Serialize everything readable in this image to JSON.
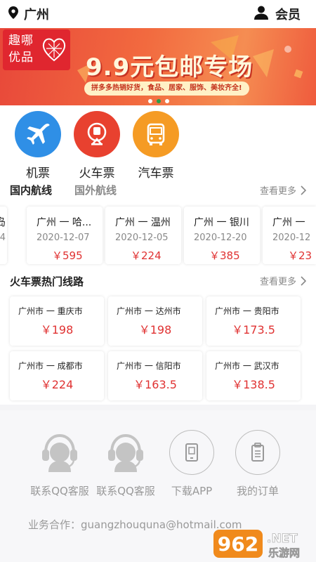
{
  "header": {
    "location": "广州",
    "member_label": "会员"
  },
  "banner": {
    "logo_text": "趣哪优品",
    "title": "9.9元包邮专场",
    "subtitle": "拼多多热销好货，食品、居家、服饰、美妆齐全!"
  },
  "categories": [
    {
      "label": "机票",
      "icon": "airplane-icon",
      "color": "#2f8fe6"
    },
    {
      "label": "火车票",
      "icon": "train-icon",
      "color": "#e8412f"
    },
    {
      "label": "汽车票",
      "icon": "bus-icon",
      "color": "#f59b24"
    }
  ],
  "flights": {
    "tab_domestic": "国内航线",
    "tab_international": "国外航线",
    "more": "查看更多",
    "cards": [
      {
        "route": "广州 一 哈...",
        "date": "2020-12-07",
        "price": "￥595"
      },
      {
        "route": "广州 一 温州",
        "date": "2020-12-05",
        "price": "￥224"
      },
      {
        "route": "广州 一 银川",
        "date": "2020-12-20",
        "price": "￥385"
      },
      {
        "route": "广州 一",
        "date": "2020-12",
        "price": "￥23"
      }
    ],
    "partial_left": {
      "route": "岛",
      "date": "4"
    }
  },
  "trains": {
    "title": "火车票热门线路",
    "more": "查看更多",
    "cards": [
      {
        "route": "广州市 一 重庆市",
        "price": "￥198"
      },
      {
        "route": "广州市 一 达州市",
        "price": "￥198"
      },
      {
        "route": "广州市 一 贵阳市",
        "price": "￥173.5"
      },
      {
        "route": "广州市 一 成都市",
        "price": "￥224"
      },
      {
        "route": "广州市 一 信阳市",
        "price": "￥163.5"
      },
      {
        "route": "广州市 一 武汉市",
        "price": "￥138.5"
      }
    ]
  },
  "footer": {
    "items": [
      {
        "label": "联系QQ客服",
        "icon": "customer-service-icon"
      },
      {
        "label": "联系QQ客服",
        "icon": "customer-service-icon"
      },
      {
        "label": "下载APP",
        "icon": "phone-icon"
      },
      {
        "label": "我的订单",
        "icon": "clipboard-icon"
      }
    ],
    "business": "业务合作：guangzhouquna@hotmail.com"
  },
  "watermark": {
    "text": "962",
    "suffix": ".NET",
    "site": "乐游网"
  },
  "colors": {
    "price": "#e03232",
    "accent": "#e8412f"
  }
}
